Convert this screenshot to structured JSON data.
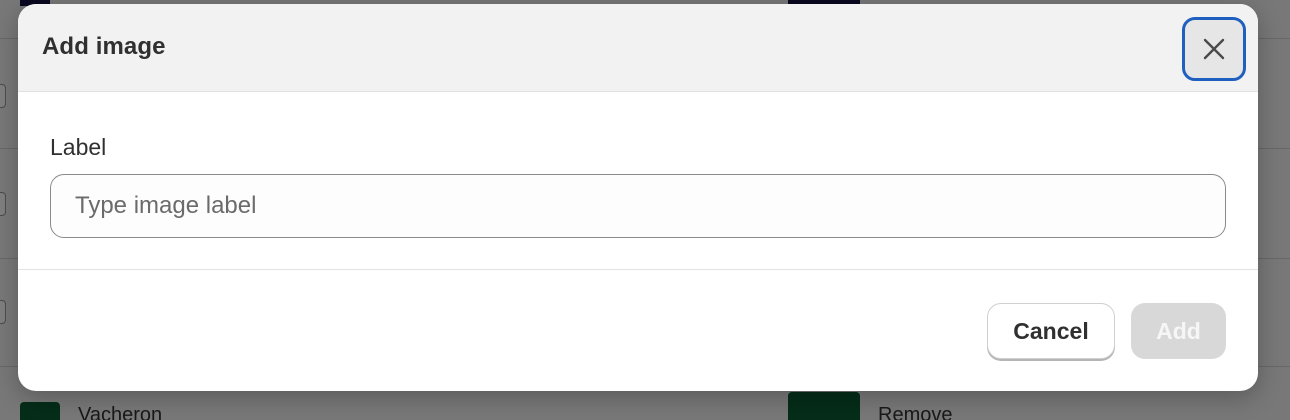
{
  "modal": {
    "title": "Add image",
    "close_icon": "close-icon"
  },
  "form": {
    "label_text": "Label",
    "label_input": {
      "value": "",
      "placeholder": "Type image label"
    }
  },
  "footer": {
    "cancel_label": "Cancel",
    "add_label": "Add",
    "add_disabled": true
  },
  "background": {
    "row_text_left": "Vacheron",
    "row_text_right": "Remove"
  },
  "colors": {
    "focus_ring": "#1f5fc0",
    "overlay": "rgba(0,0,0,0.5)",
    "disabled_button": "#d8d8d8"
  }
}
